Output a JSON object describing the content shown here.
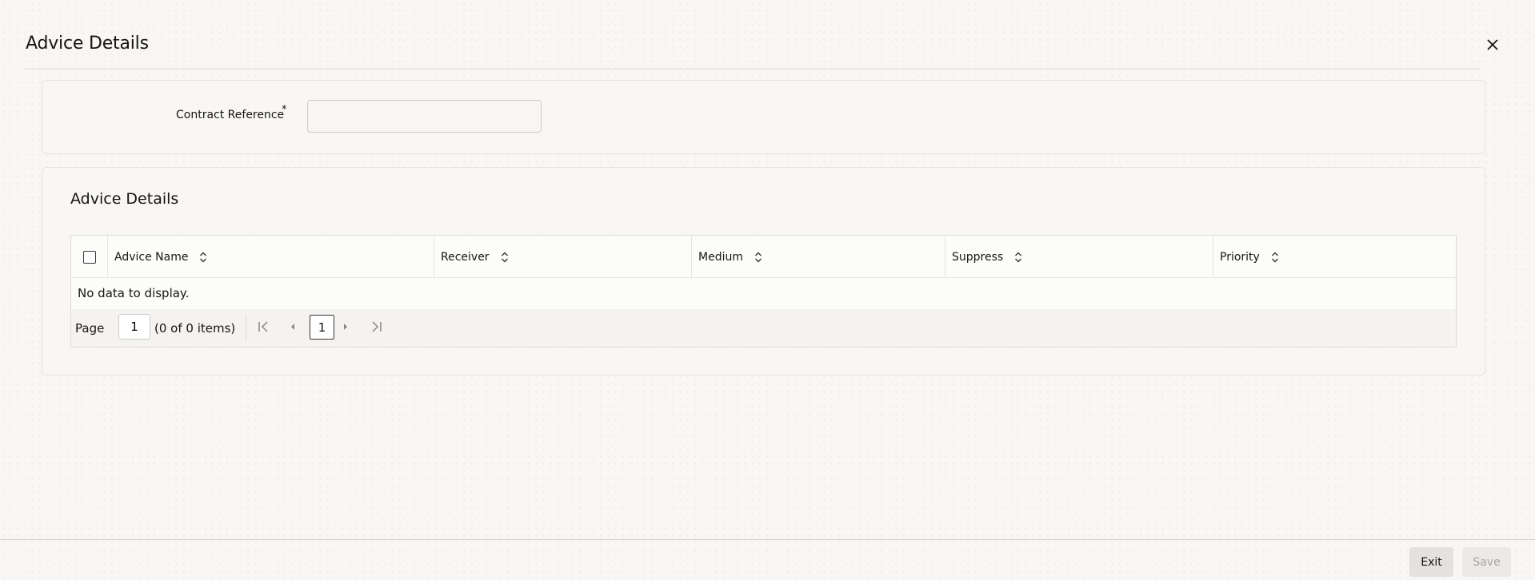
{
  "dialog": {
    "title": "Advice Details"
  },
  "contract": {
    "label": "Contract Reference",
    "required_mark": "*",
    "value": "",
    "placeholder": ""
  },
  "advice_section": {
    "title": "Advice Details",
    "columns": [
      {
        "label": "Advice Name"
      },
      {
        "label": "Receiver"
      },
      {
        "label": "Medium"
      },
      {
        "label": "Suppress"
      },
      {
        "label": "Priority"
      }
    ],
    "rows": [],
    "empty_text": "No data to display.",
    "pagination": {
      "page_label": "Page",
      "page_value": "1",
      "items_text": "(0 of 0 items)",
      "current_page": "1"
    }
  },
  "footer": {
    "exit_label": "Exit",
    "save_label": "Save"
  },
  "icons": [
    "close-icon",
    "sort-icon",
    "first-page-icon",
    "previous-page-icon",
    "next-page-icon",
    "last-page-icon"
  ],
  "colors": {
    "text": "#161513",
    "disabled_text": "#a9a6a1",
    "border": "#dedcd8",
    "top_bar": "#312d2a"
  }
}
